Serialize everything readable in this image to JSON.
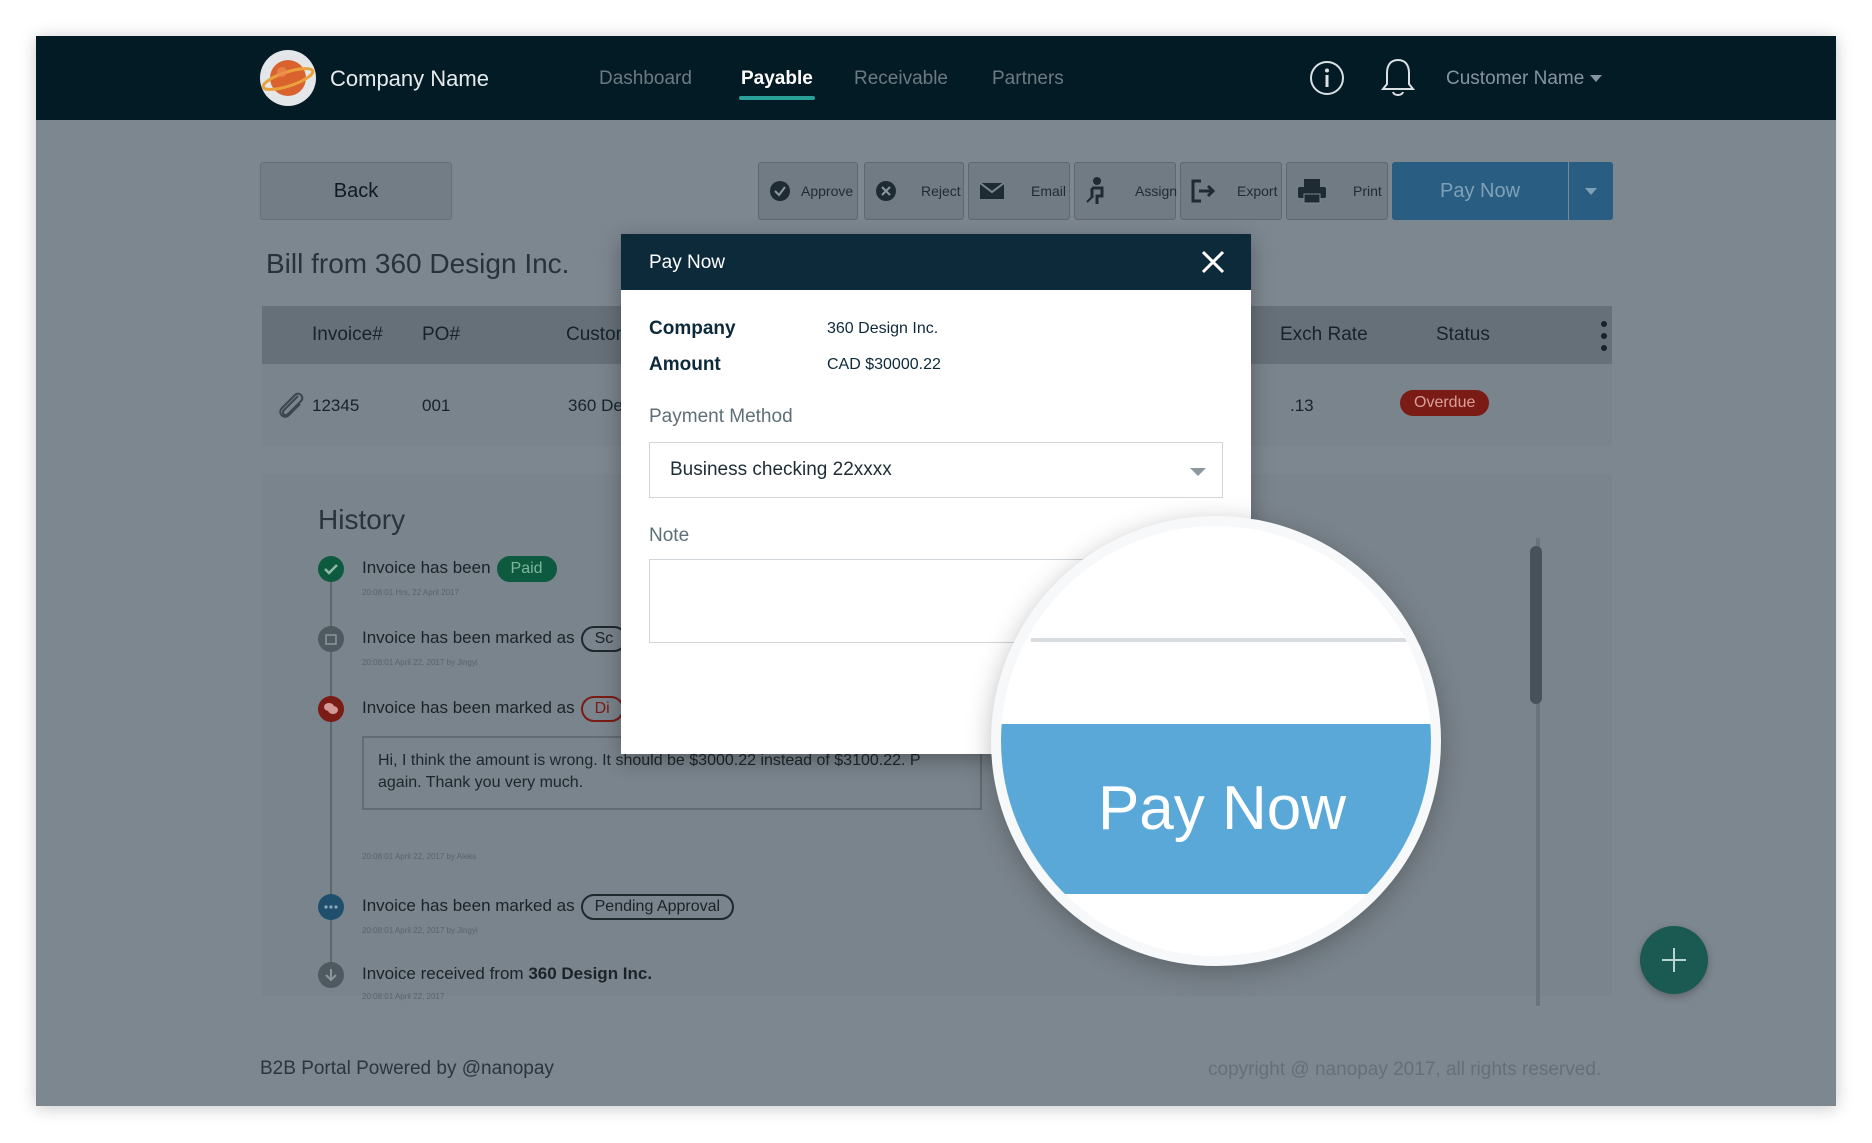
{
  "header": {
    "brand": "Company Name",
    "nav": [
      "Dashboard",
      "Payable",
      "Receivable",
      "Partners"
    ],
    "active_nav": "Payable",
    "user": "Customer Name"
  },
  "toolbar": {
    "back": "Back",
    "approve": "Approve",
    "reject": "Reject",
    "email": "Email",
    "assign": "Assign",
    "export": "Export",
    "print": "Print",
    "pay_now": "Pay Now"
  },
  "bill": {
    "title": "Bill from 360 Design Inc."
  },
  "table": {
    "headers": [
      "Invoice#",
      "PO#",
      "Customer",
      "Exch Rate",
      "Status"
    ],
    "row": {
      "invoice": "12345",
      "po": "001",
      "customer": "360 Design",
      "exch_rate": ".13",
      "status": "Overdue"
    }
  },
  "history": {
    "title": "History",
    "events": [
      {
        "text": "Invoice has been",
        "pill": "Paid",
        "meta": "20:08:01 Hrs, 22 April 2017"
      },
      {
        "text": "Invoice has been marked as",
        "pill": "Sc",
        "meta": "20:08:01 April 22, 2017 by Jingyi"
      },
      {
        "text": "Invoice has been marked as",
        "pill": "Di",
        "meta": "20:08:01 April 22, 2017 by Aleks"
      },
      {
        "text": "Invoice has been marked as",
        "pill": "Pending Approval",
        "meta": "20:08:01 April 22, 2017 by Jingyi"
      },
      {
        "text": "Invoice received from",
        "bold": "360 Design Inc.",
        "meta": "20:08:01 April 22, 2017"
      }
    ],
    "comment": "Hi, I think the amount is wrong. It should be $3000.22 instead of $3100.22. P again. Thank you very much."
  },
  "footer": {
    "left": "B2B Portal Powered by @nanopay",
    "right": "copyright @ nanopay 2017, all rights reserved."
  },
  "modal": {
    "title": "Pay Now",
    "company_label": "Company",
    "company_value": "360 Design Inc.",
    "amount_label": "Amount",
    "amount_value": "CAD $30000.22",
    "payment_method_label": "Payment Method",
    "payment_method_value": "Business checking 22xxxx",
    "note_label": "Note",
    "pay_button": "Pay Now"
  },
  "colors": {
    "topbar": "#031b25",
    "accent": "#2aa198",
    "pay_button": "#59a8d8",
    "overdue": "#c62828",
    "paid": "#1e8a5e"
  }
}
